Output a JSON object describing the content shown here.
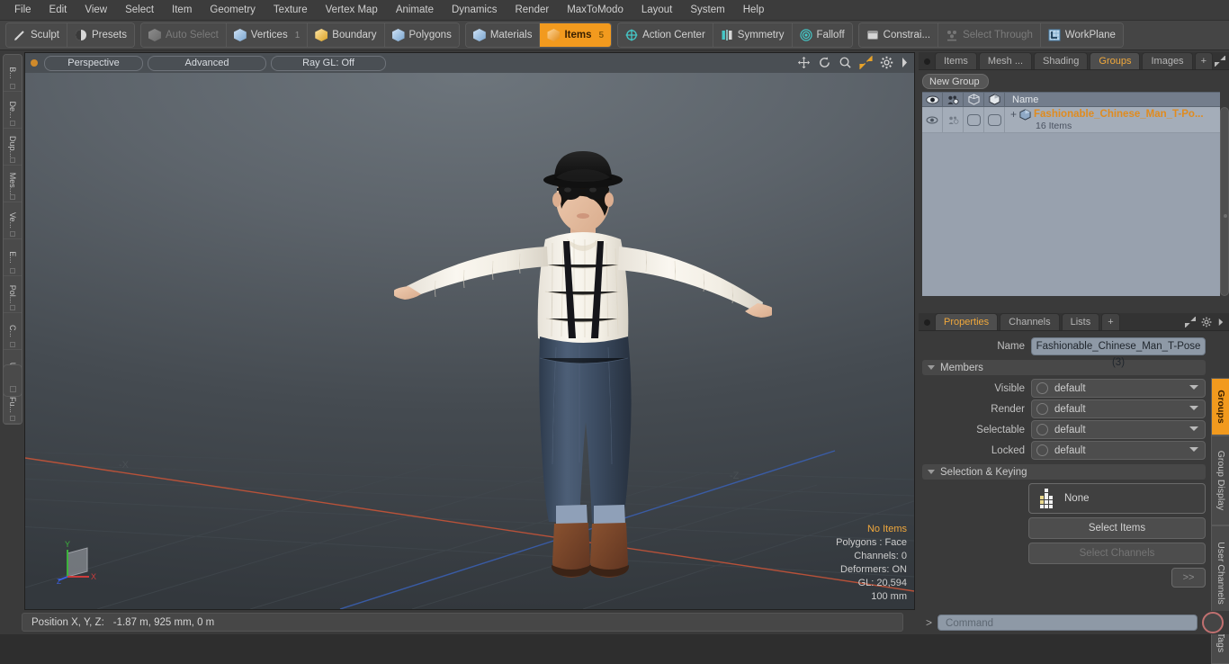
{
  "menu": {
    "items": [
      "File",
      "Edit",
      "View",
      "Select",
      "Item",
      "Geometry",
      "Texture",
      "Vertex Map",
      "Animate",
      "Dynamics",
      "Render",
      "MaxToModo",
      "Layout",
      "System",
      "Help"
    ]
  },
  "toolbar": {
    "groups": [
      {
        "buttons": [
          {
            "label": "Sculpt",
            "icon": "sculpt-icon",
            "state": "normal",
            "count": ""
          },
          {
            "label": "Presets",
            "icon": "presets-icon",
            "state": "normal",
            "count": ""
          }
        ]
      },
      {
        "buttons": [
          {
            "label": "Auto Select",
            "icon": "cube-grey-icon",
            "state": "disabled",
            "count": ""
          },
          {
            "label": "Vertices",
            "icon": "cube-blue-icon",
            "state": "normal",
            "count": "1"
          },
          {
            "label": "Boundary",
            "icon": "cube-yellow-icon",
            "state": "normal",
            "count": ""
          },
          {
            "label": "Polygons",
            "icon": "cube-blue-icon",
            "state": "normal",
            "count": ""
          }
        ]
      },
      {
        "buttons": [
          {
            "label": "Materials",
            "icon": "cube-blue-icon",
            "state": "normal",
            "count": ""
          },
          {
            "label": "Items",
            "icon": "cube-orange-icon",
            "state": "active",
            "count": "5"
          }
        ]
      },
      {
        "buttons": [
          {
            "label": "Action Center",
            "icon": "action-center-icon",
            "state": "normal",
            "count": ""
          },
          {
            "label": "Symmetry",
            "icon": "symmetry-icon",
            "state": "normal",
            "count": ""
          },
          {
            "label": "Falloff",
            "icon": "falloff-icon",
            "state": "normal",
            "count": ""
          }
        ]
      },
      {
        "buttons": [
          {
            "label": "Constrai...",
            "icon": "constraint-icon",
            "state": "normal",
            "count": ""
          },
          {
            "label": "Select Through",
            "icon": "select-through-icon",
            "state": "disabled",
            "count": ""
          },
          {
            "label": "WorkPlane",
            "icon": "workplane-icon",
            "state": "normal",
            "count": ""
          }
        ]
      }
    ]
  },
  "left_strip": {
    "tabs": [
      "B...",
      "De...",
      "Dup...",
      "Mes...",
      "Ve...",
      "E...",
      "Pol...",
      "C...",
      "UV",
      "Fu..."
    ]
  },
  "viewport": {
    "pills": [
      "Perspective",
      "Advanced",
      "Ray GL: Off"
    ],
    "header_icons": [
      "move-icon",
      "rotate-icon",
      "zoom-icon",
      "fit-icon",
      "gear-icon",
      "chevron-right-icon"
    ],
    "axis_labels": {
      "neg_x": "-X",
      "neg_z": "-Z"
    },
    "gizmo_axes": {
      "y": "Y",
      "x": "X",
      "z": "Z"
    },
    "stats": {
      "selection": "No Items",
      "polygons": "Polygons : Face",
      "channels": "Channels: 0",
      "deformers": "Deformers: ON",
      "gl": "GL: 20,594",
      "scale": "100 mm"
    }
  },
  "right_top": {
    "tabs": [
      "Items",
      "Mesh ...",
      "Shading",
      "Groups",
      "Images"
    ],
    "selected_tab": "Groups",
    "add_tab_label": "+",
    "new_group_button": "New Group",
    "list_header": {
      "columns": [
        "eye-icon",
        "render-icon",
        "wire-icon",
        "shade-icon"
      ],
      "name": "Name"
    },
    "rows": [
      {
        "expander": "+",
        "icon": "group-icon",
        "name": "Fashionable_Chinese_Man_T-Po...",
        "sub": "16 Items"
      }
    ]
  },
  "properties": {
    "tabs": [
      "Properties",
      "Channels",
      "Lists"
    ],
    "selected_tab": "Properties",
    "add_tab_label": "+",
    "name_label": "Name",
    "name_value": "Fashionable_Chinese_Man_T-Pose (3)",
    "members_section": "Members",
    "fields": [
      {
        "label": "Visible",
        "value": "default"
      },
      {
        "label": "Render",
        "value": "default"
      },
      {
        "label": "Selectable",
        "value": "default"
      },
      {
        "label": "Locked",
        "value": "default"
      }
    ],
    "selection_section": "Selection & Keying",
    "none_button": "None",
    "select_items_button": "Select Items",
    "select_channels_button": "Select Channels",
    "more_button": ">>"
  },
  "right_strip": {
    "tabs": [
      "Groups",
      "Group Display",
      "User Channels",
      "Tags"
    ],
    "selected_tab": "Groups"
  },
  "status": {
    "position_label": "Position X, Y, Z:",
    "position_value": "-1.87 m, 925 mm, 0 m"
  },
  "command": {
    "prompt": ">",
    "placeholder": "Command",
    "record_icon": "record-icon"
  },
  "colors": {
    "accent": "#f29a1e",
    "panel": "#3a3a3a",
    "list": "#98a1ae",
    "x_axis": "#c0533a",
    "z_axis": "#3f63b5",
    "y_axis": "#3cb33c"
  }
}
